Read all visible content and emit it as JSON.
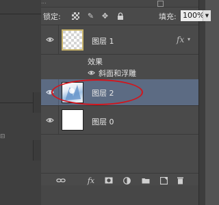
{
  "header": {
    "blend_mode": "...",
    "lock_transparency_checkbox": "",
    "locked_label": "锁定:",
    "fill_label": "填充:",
    "fill_value": "100%"
  },
  "layers": [
    {
      "name": "图层 1",
      "fx": "fx",
      "effects_label": "效果",
      "effect_name": "斜面和浮雕"
    },
    {
      "name": "图层 2"
    },
    {
      "name": "图层 0"
    }
  ],
  "bottom_toolbar": {
    "fx": "fx"
  },
  "colors": {
    "selected_row": "#5c6b83",
    "highlight_ellipse": "#d3141b",
    "panel_bg": "#4a4a4a"
  }
}
